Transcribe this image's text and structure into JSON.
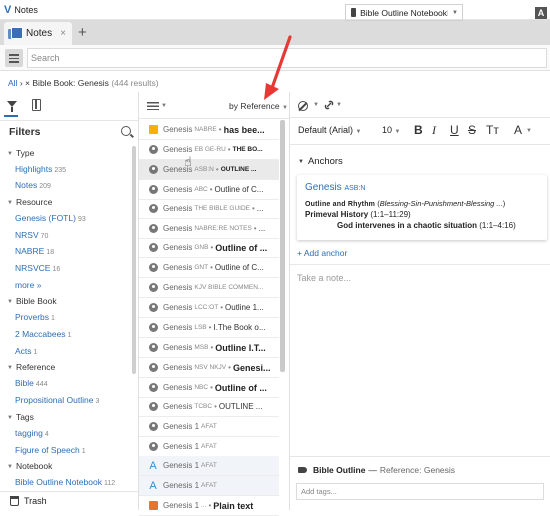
{
  "window": {
    "title": "Notes"
  },
  "tabs": [
    {
      "label": "Notes",
      "close": "×"
    }
  ],
  "tab_add": "+",
  "search": {
    "placeholder": "Search"
  },
  "breadcrumb": {
    "all": "All",
    "sep": "›",
    "close": "×",
    "label": "Bible Book: Genesis",
    "count": "(444 results)"
  },
  "filters": {
    "title": "Filters",
    "sections": [
      {
        "label": "Type",
        "items": [
          {
            "label": "Highlights",
            "count": "235"
          },
          {
            "label": "Notes",
            "count": "209"
          }
        ]
      },
      {
        "label": "Resource",
        "items": [
          {
            "label": "Genesis (FOTL)",
            "count": "93"
          },
          {
            "label": "NRSV",
            "count": "70"
          },
          {
            "label": "NABRE",
            "count": "18"
          },
          {
            "label": "NRSVCE",
            "count": "16"
          },
          {
            "label": "more »",
            "count": ""
          }
        ]
      },
      {
        "label": "Bible Book",
        "items": [
          {
            "label": "Proverbs",
            "count": "1"
          },
          {
            "label": "2 Maccabees",
            "count": "1"
          },
          {
            "label": "Acts",
            "count": "1"
          }
        ]
      },
      {
        "label": "Reference",
        "items": [
          {
            "label": "Bible",
            "count": "444"
          },
          {
            "label": "Propositional Outline",
            "count": "3"
          }
        ]
      },
      {
        "label": "Tags",
        "items": [
          {
            "label": "tagging",
            "count": "4"
          },
          {
            "label": "Figure of Speech",
            "count": "1"
          }
        ]
      },
      {
        "label": "Notebook",
        "items": [
          {
            "label": "Bible Outline Notebook",
            "count": "112"
          }
        ]
      }
    ],
    "trash": "Trash"
  },
  "list": {
    "sort_label": "by Reference",
    "rows": [
      {
        "icon": "note",
        "ref": "Genesis",
        "src": "NABRE",
        "sep": "•",
        "text": "has bee...",
        "style": "b"
      },
      {
        "icon": "person",
        "ref": "Genesis",
        "src": "EB GE-RU",
        "sep": "•",
        "text": "THE BO...",
        "style": "bs"
      },
      {
        "icon": "person",
        "ref": "Genesis",
        "src": "ASB:N",
        "sep": "•",
        "text": "OUTLINE ...",
        "style": "bs"
      },
      {
        "icon": "person",
        "ref": "Genesis",
        "src": "ABC",
        "sep": "•",
        "text": "Outline of C...",
        "style": "n"
      },
      {
        "icon": "person",
        "ref": "Genesis",
        "src": "THE BIBLE GUIDE",
        "sep": "•",
        "text": "...",
        "style": "n"
      },
      {
        "icon": "person",
        "ref": "Genesis",
        "src": "NABRE:RE NOTES",
        "sep": "•",
        "text": "...",
        "style": "n"
      },
      {
        "icon": "person",
        "ref": "Genesis",
        "src": "GNB",
        "sep": "•",
        "text": "Outline of ...",
        "style": "b"
      },
      {
        "icon": "person",
        "ref": "Genesis",
        "src": "GNT",
        "sep": "•",
        "text": "Outline of C...",
        "style": "n"
      },
      {
        "icon": "person",
        "ref": "Genesis",
        "src": "KJV BIBLE COMMEN...",
        "sep": "",
        "text": "",
        "style": "n"
      },
      {
        "icon": "person",
        "ref": "Genesis",
        "src": "LCC:OT",
        "sep": "•",
        "text": "Outline 1...",
        "style": "n"
      },
      {
        "icon": "person",
        "ref": "Genesis",
        "src": "LSB",
        "sep": "•",
        "text": "I.The Book o...",
        "style": "n"
      },
      {
        "icon": "person",
        "ref": "Genesis",
        "src": "MSB",
        "sep": "•",
        "text": "Outline I.T...",
        "style": "b"
      },
      {
        "icon": "person",
        "ref": "Genesis",
        "src": "NSV NKJV",
        "sep": "•",
        "text": "Genesi...",
        "style": "b"
      },
      {
        "icon": "person",
        "ref": "Genesis",
        "src": "NBC",
        "sep": "•",
        "text": "Outline of ...",
        "style": "b"
      },
      {
        "icon": "person",
        "ref": "Genesis",
        "src": "TCBC",
        "sep": "•",
        "text": "OUTLINE ...",
        "style": "n"
      },
      {
        "icon": "person",
        "ref": "Genesis 1",
        "src": "AFAT",
        "sep": "",
        "text": "",
        "style": "n"
      },
      {
        "icon": "person",
        "ref": "Genesis 1",
        "src": "AFAT",
        "sep": "",
        "text": "",
        "style": "n"
      },
      {
        "icon": "A",
        "ref": "Genesis 1",
        "src": "AFAT",
        "sep": "",
        "text": "",
        "style": "n"
      },
      {
        "icon": "A",
        "ref": "Genesis 1",
        "src": "AFAT",
        "sep": "",
        "text": "",
        "style": "n"
      },
      {
        "icon": "orange",
        "ref": "Genesis 1",
        "src": "...",
        "sep": "•",
        "text": "Plain text",
        "style": "b"
      }
    ]
  },
  "editor": {
    "notebook": "Bible Outline Notebook",
    "font": "Default (Arial)",
    "size": "10",
    "format": {
      "bold": "B",
      "italic": "I",
      "underline": "U",
      "strike": "S",
      "caps": "Tт",
      "color": "A",
      "highlight": "A"
    },
    "anchors_title": "Anchors",
    "anchor": {
      "ref": "Genesis",
      "src": "ASB:N",
      "line1_sc": "Outline and Rhythm",
      "line1_it": "Blessing-Sin-Punishment-Blessing ...",
      "line2_b": "Primeval History",
      "line2": "(1:1–11:29)",
      "line3_b": "God intervenes in a chaotic situation",
      "line3": "(1:1–4:16)"
    },
    "add_anchor": "+ Add anchor",
    "take_note": "Take a note...",
    "footer": {
      "title": "Bible Outline",
      "dash": "—",
      "ref": "Reference: Genesis",
      "tags_placeholder": "Add tags..."
    }
  },
  "colors": {
    "accent": "#2c6fb7",
    "arrow": "#e53935",
    "highlight_note": "#f0b400"
  }
}
